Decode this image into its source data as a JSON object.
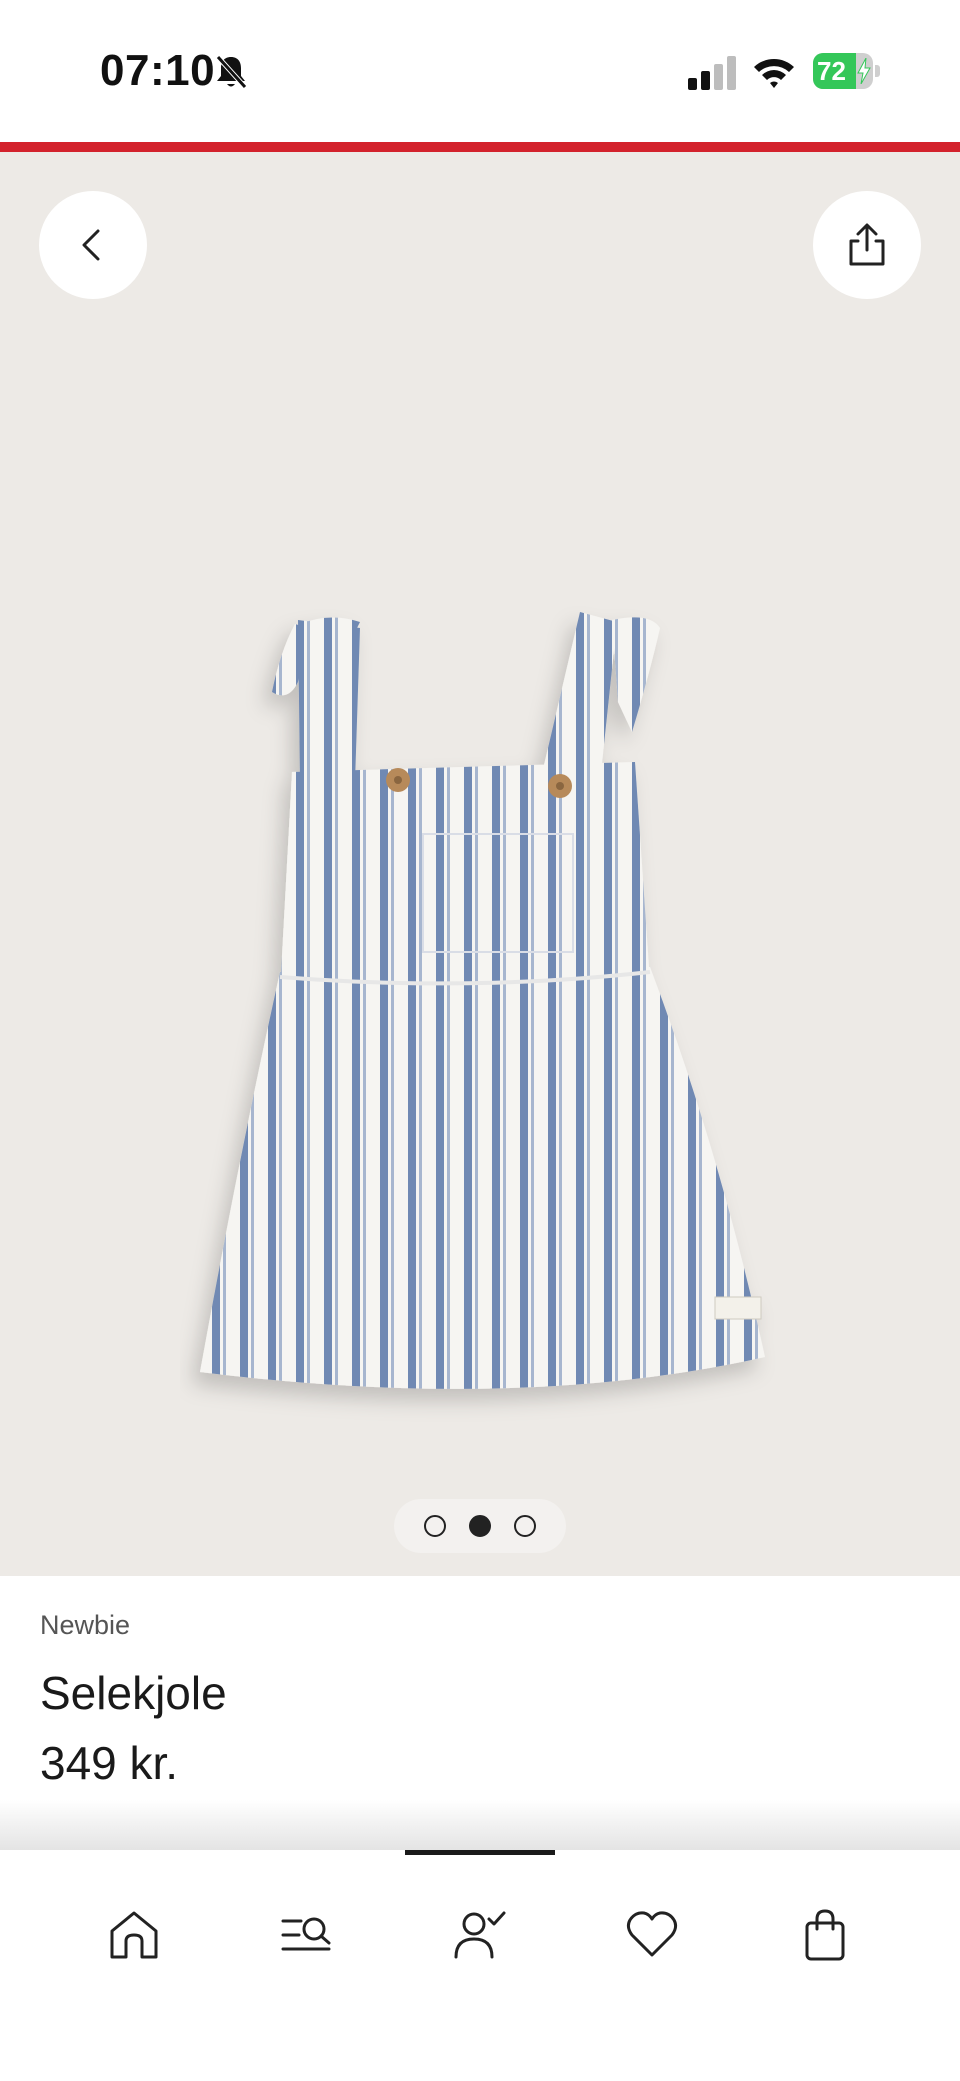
{
  "status_bar": {
    "time": "07:10",
    "battery_percent": "72",
    "battery_level": 0.72,
    "icons": [
      "bell-slash-icon",
      "cellular-signal-icon",
      "wifi-icon",
      "battery-charging-icon"
    ]
  },
  "colors": {
    "accent_line": "#d3222c",
    "gallery_background": "#edeae6",
    "battery_green": "#34c759",
    "stripe_blue": "#7089b3"
  },
  "gallery": {
    "back_icon": "chevron-left-icon",
    "share_icon": "share-icon",
    "image_description_name": "product-image",
    "page_count": 3,
    "active_page": 2
  },
  "product": {
    "brand": "Newbie",
    "name": "Selekjole",
    "price": "349 kr."
  },
  "bottom_nav": {
    "items": [
      {
        "icon": "home-icon",
        "name": "nav-home"
      },
      {
        "icon": "search-list-icon",
        "name": "nav-search"
      },
      {
        "icon": "account-check-icon",
        "name": "nav-account"
      },
      {
        "icon": "heart-icon",
        "name": "nav-favorites"
      },
      {
        "icon": "shopping-bag-icon",
        "name": "nav-bag"
      }
    ]
  }
}
